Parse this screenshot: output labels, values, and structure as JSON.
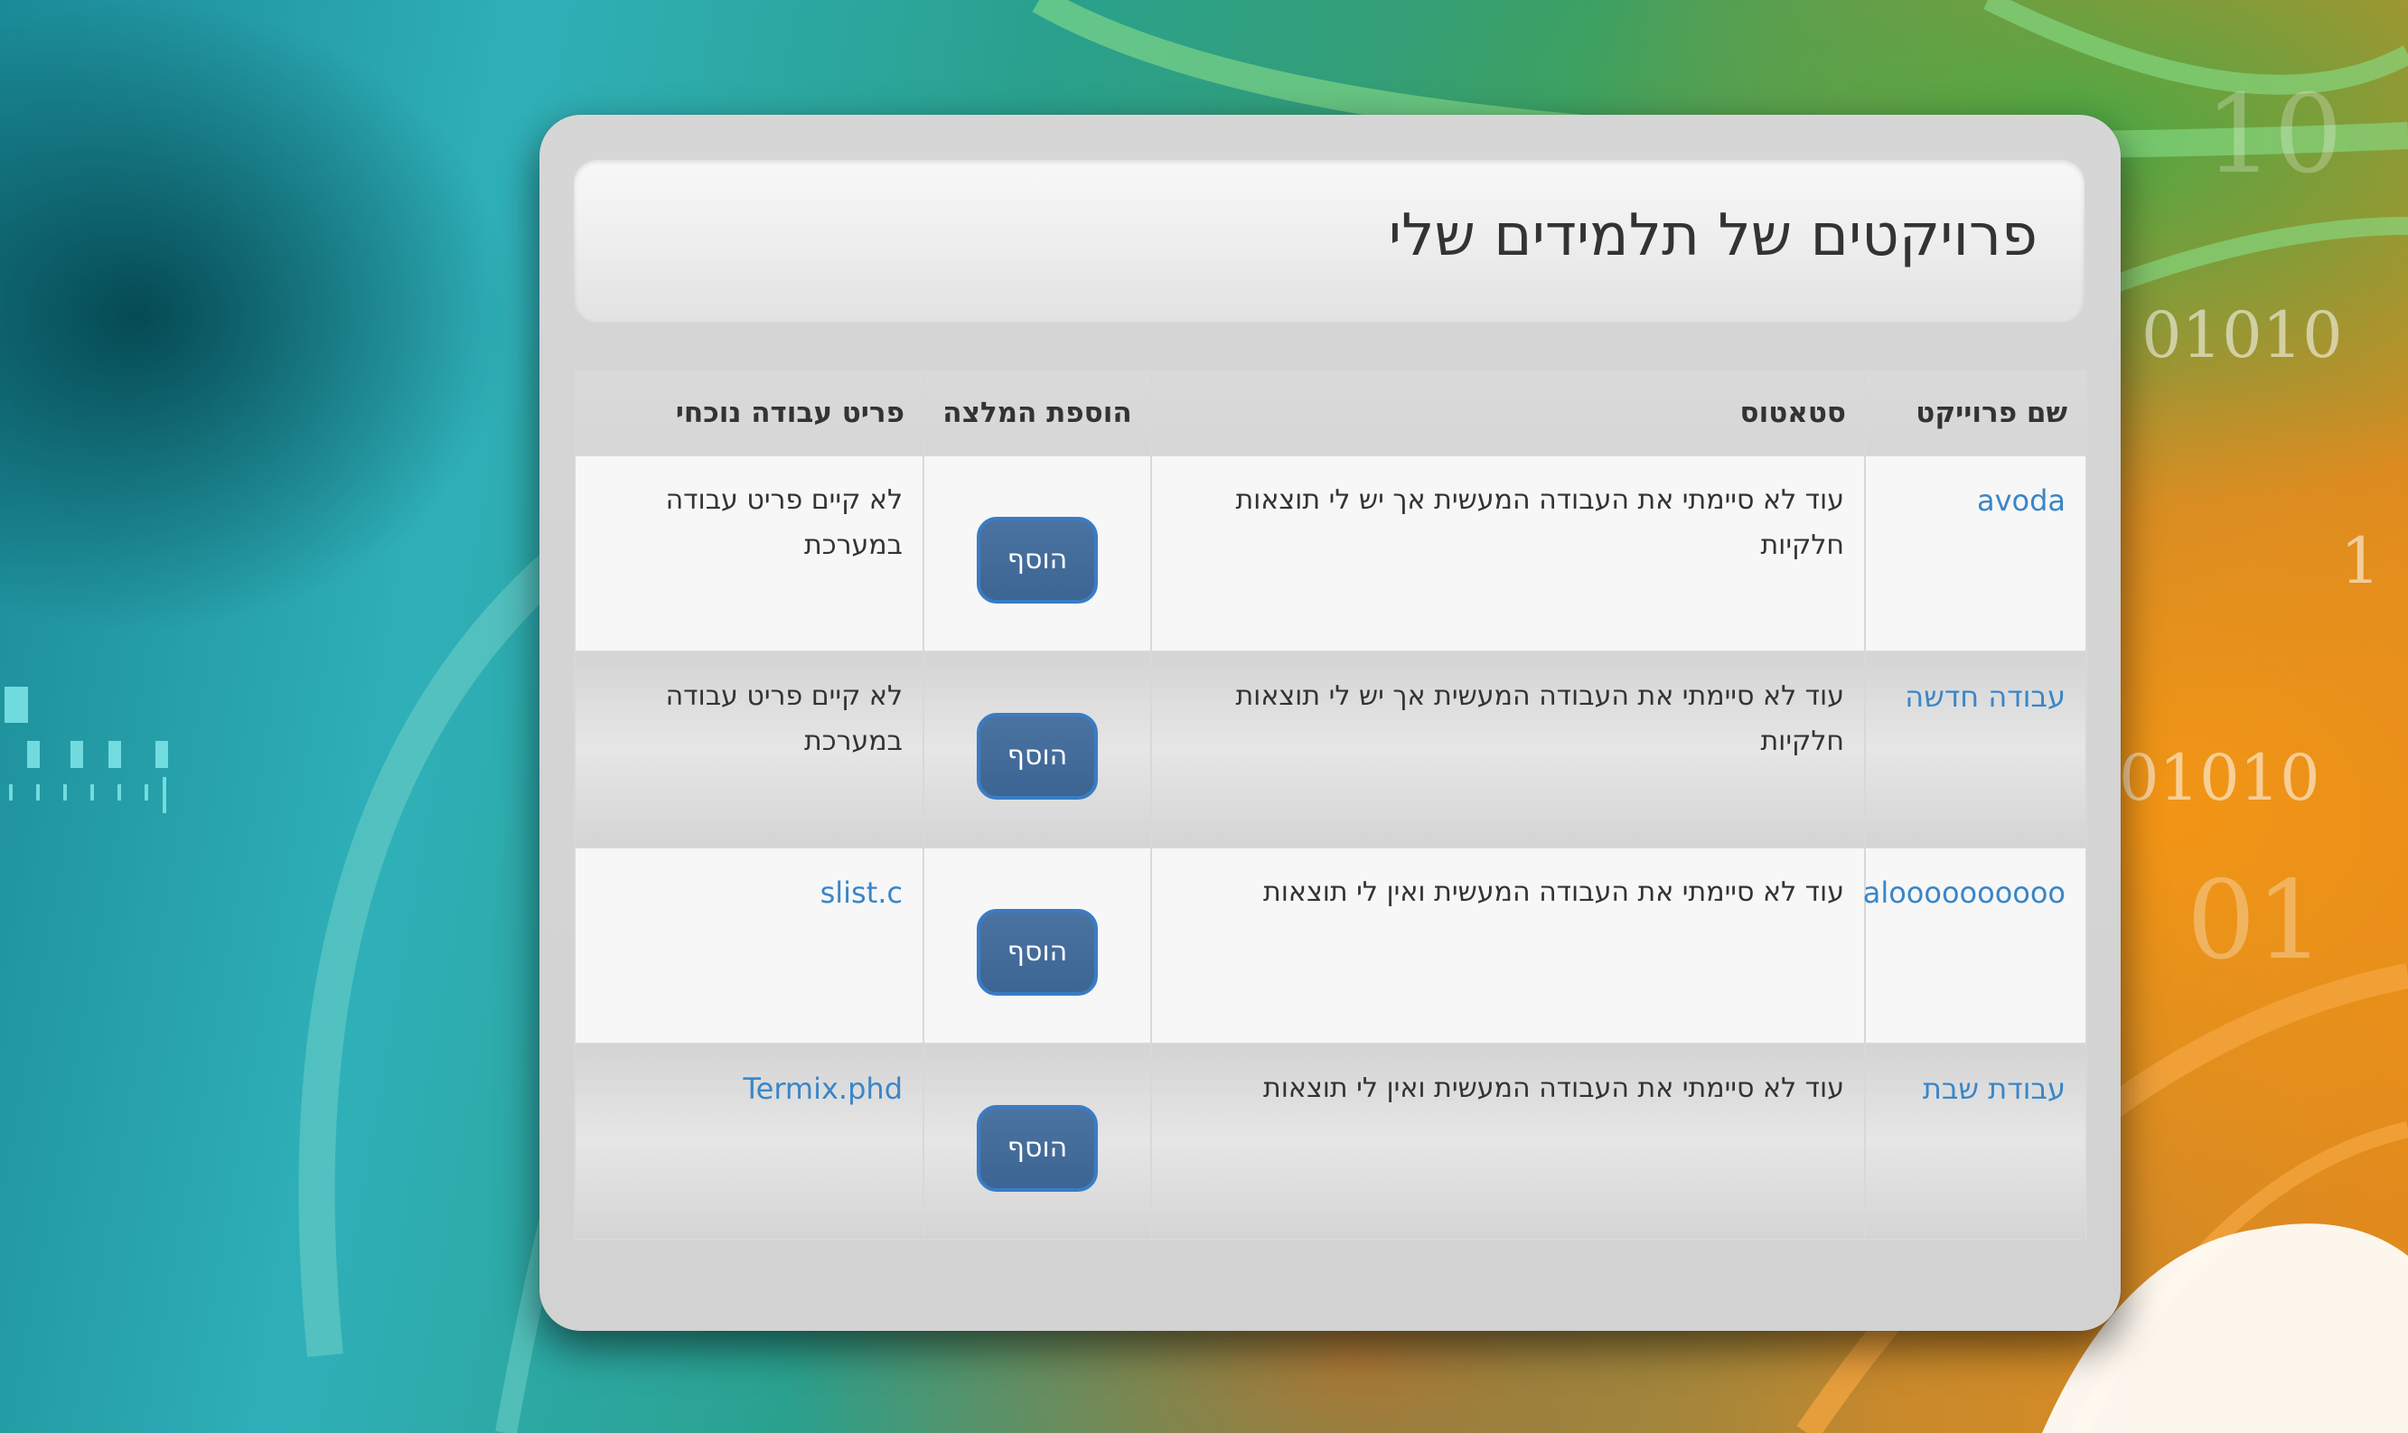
{
  "page": {
    "title": "פרויקטים של תלמידים שלי"
  },
  "background": {
    "binary_digits": [
      "01010",
      "1",
      "01010",
      "01",
      "10"
    ]
  },
  "table": {
    "headers": {
      "project_name": "שם פרוייקט",
      "status": "סטאטוס",
      "add_recommendation": "הוספת המלצה",
      "current_work_item": "פריט עבודה נוכחי"
    },
    "rows": [
      {
        "project_name": "avoda",
        "status": "עוד לא סיימתי את העבודה המעשית אך יש לי תוצאות חלקיות",
        "button_label": "הוסף",
        "current_work_item": "לא קיים פריט עבודה במערכת",
        "work_item_is_link": false
      },
      {
        "project_name": "עבודה חדשה",
        "status": "עוד לא סיימתי את העבודה המעשית אך יש לי תוצאות חלקיות",
        "button_label": "הוסף",
        "current_work_item": "לא קיים פריט עבודה במערכת",
        "work_item_is_link": false
      },
      {
        "project_name": "aloooooooooo",
        "status": "עוד לא סיימתי את העבודה המעשית ואין לי תוצאות",
        "button_label": "הוסף",
        "current_work_item": "slist.c",
        "work_item_is_link": true
      },
      {
        "project_name": "עבודת שבת",
        "status": "עוד לא סיימתי את העבודה המעשית ואין לי תוצאות",
        "button_label": "הוסף",
        "current_work_item": "Termix.phd",
        "work_item_is_link": true
      }
    ]
  },
  "colors": {
    "link": "#3a86c8",
    "button": "#46709e",
    "button_border": "#3a7cc4",
    "card": "#d4d4d4"
  }
}
